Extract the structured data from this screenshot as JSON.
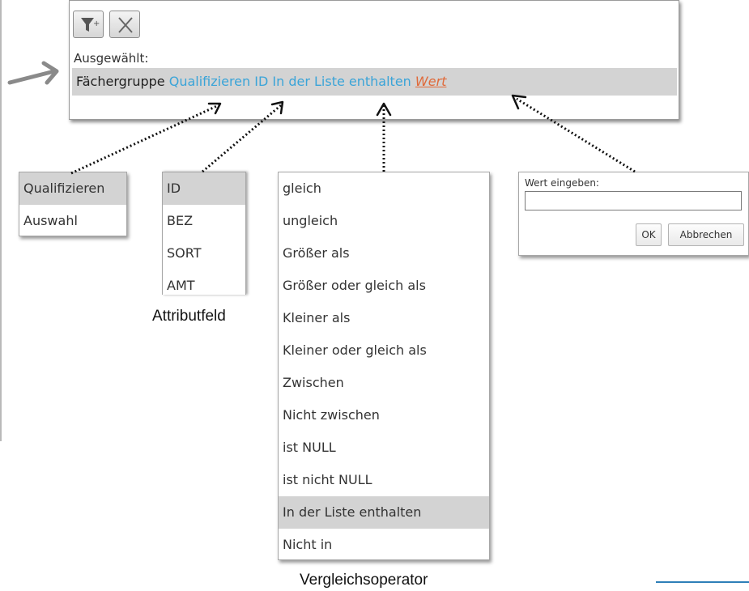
{
  "filter_panel": {
    "add_filter_icon": "filter-add-icon",
    "clear_icon": "close-icon",
    "selected_label": "Ausgewählt:",
    "expression": {
      "field_group": "Fächergruppe",
      "qualifier": "Qualifizieren",
      "attribute": "ID",
      "operator": "In der Liste enthalten",
      "value": "Wert"
    }
  },
  "qualifier_list": {
    "items": [
      "Qualifizieren",
      "Auswahl"
    ],
    "selected_index": 0
  },
  "attribute_list": {
    "items": [
      "ID",
      "BEZ",
      "SORT",
      "AMT"
    ],
    "selected_index": 0,
    "caption": "Attributfeld"
  },
  "operator_list": {
    "items": [
      "gleich",
      "ungleich",
      "Größer als",
      "Größer oder gleich als",
      "Kleiner als",
      "Kleiner oder gleich als",
      "Zwischen",
      "Nicht zwischen",
      "ist NULL",
      "ist nicht NULL",
      "In der Liste enthalten",
      "Nicht in"
    ],
    "selected_index": 10,
    "caption": "Vergleichsoperator"
  },
  "value_dialog": {
    "label": "Wert eingeben:",
    "input_value": "",
    "ok_label": "OK",
    "cancel_label": "Abbrechen"
  },
  "colors": {
    "accent_blue": "#3aa4d8",
    "value_link": "#e06a3a",
    "selected_bg": "#d3d3d3",
    "bottom_rule": "#2e7fb8"
  }
}
